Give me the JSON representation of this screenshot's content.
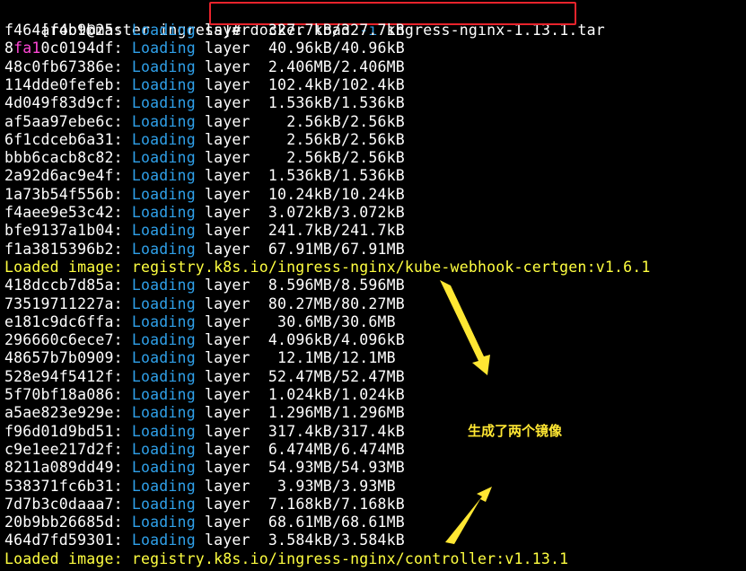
{
  "prompt": "[root@master ingress]# ",
  "command": {
    "base": "docker load ",
    "flag": "-i",
    "arg": " ingress-nginx-1.13.1.tar"
  },
  "annotation": "生成了两个镜像",
  "loading_word": "Loading layer",
  "loaded_label": "Loaded image: ",
  "lines": [
    {
      "kind": "layer",
      "hash": "f464af4b9b25",
      "progress": "327.7kB/327.7kB"
    },
    {
      "kind": "layer",
      "hash_parts": [
        "8",
        "fa1",
        "0c0194df"
      ],
      "progress": "40.96kB/40.96kB"
    },
    {
      "kind": "layer",
      "hash": "48c0fb67386e",
      "progress": "2.406MB/2.406MB"
    },
    {
      "kind": "layer",
      "hash": "114dde0fefeb",
      "progress": "102.4kB/102.4kB"
    },
    {
      "kind": "layer",
      "hash": "4d049f83d9cf",
      "progress": "1.536kB/1.536kB"
    },
    {
      "kind": "layer",
      "hash": "af5aa97ebe6c",
      "progress": "  2.56kB/2.56kB"
    },
    {
      "kind": "layer",
      "hash": "6f1cdceb6a31",
      "progress": "  2.56kB/2.56kB"
    },
    {
      "kind": "layer",
      "hash": "bbb6cacb8c82",
      "progress": "  2.56kB/2.56kB"
    },
    {
      "kind": "layer",
      "hash": "2a92d6ac9e4f",
      "progress": "1.536kB/1.536kB"
    },
    {
      "kind": "layer",
      "hash": "1a73b54f556b",
      "progress": "10.24kB/10.24kB"
    },
    {
      "kind": "layer",
      "hash": "f4aee9e53c42",
      "progress": "3.072kB/3.072kB"
    },
    {
      "kind": "layer",
      "hash": "bfe9137a1b04",
      "progress": "241.7kB/241.7kB"
    },
    {
      "kind": "layer",
      "hash": "f1a3815396b2",
      "progress": "67.91MB/67.91MB"
    },
    {
      "kind": "loaded",
      "image": "registry.k8s.io/ingress-nginx/kube-webhook-certgen:v1.6.1"
    },
    {
      "kind": "layer",
      "hash": "418dccb7d85a",
      "progress": "8.596MB/8.596MB"
    },
    {
      "kind": "layer",
      "hash": "73519711227a",
      "progress": "80.27MB/80.27MB"
    },
    {
      "kind": "layer",
      "hash": "e181c9dc6ffa",
      "progress": " 30.6MB/30.6MB"
    },
    {
      "kind": "layer",
      "hash": "296660c6ece7",
      "progress": "4.096kB/4.096kB"
    },
    {
      "kind": "layer",
      "hash": "48657b7b0909",
      "progress": " 12.1MB/12.1MB"
    },
    {
      "kind": "layer",
      "hash": "528e94f5412f",
      "progress": "52.47MB/52.47MB"
    },
    {
      "kind": "layer",
      "hash": "5f70bf18a086",
      "progress": "1.024kB/1.024kB"
    },
    {
      "kind": "layer",
      "hash": "a5ae823e929e",
      "progress": "1.296MB/1.296MB"
    },
    {
      "kind": "layer",
      "hash": "f96d01d9bd51",
      "progress": "317.4kB/317.4kB"
    },
    {
      "kind": "layer",
      "hash": "c9e1ee217d2f",
      "progress": "6.474MB/6.474MB"
    },
    {
      "kind": "layer",
      "hash": "8211a089dd49",
      "progress": "54.93MB/54.93MB"
    },
    {
      "kind": "layer",
      "hash": "538371fc6b31",
      "progress": " 3.93MB/3.93MB"
    },
    {
      "kind": "layer",
      "hash": "7d7b3c0daaa7",
      "progress": "7.168kB/7.168kB"
    },
    {
      "kind": "layer",
      "hash": "20b9bb26685d",
      "progress": "68.61MB/68.61MB"
    },
    {
      "kind": "layer",
      "hash": "464d7fd59301",
      "progress": "3.584kB/3.584kB"
    },
    {
      "kind": "loaded",
      "image": "registry.k8s.io/ingress-nginx/controller:v1.13.1"
    }
  ],
  "colors": {
    "background": "#000000",
    "text": "#ffffff",
    "loading": "#2fa0e9",
    "loaded": "#ffff40",
    "hash_highlight": "#ff47d6",
    "annotation": "#ffe733",
    "command_box": "#e8232c"
  }
}
